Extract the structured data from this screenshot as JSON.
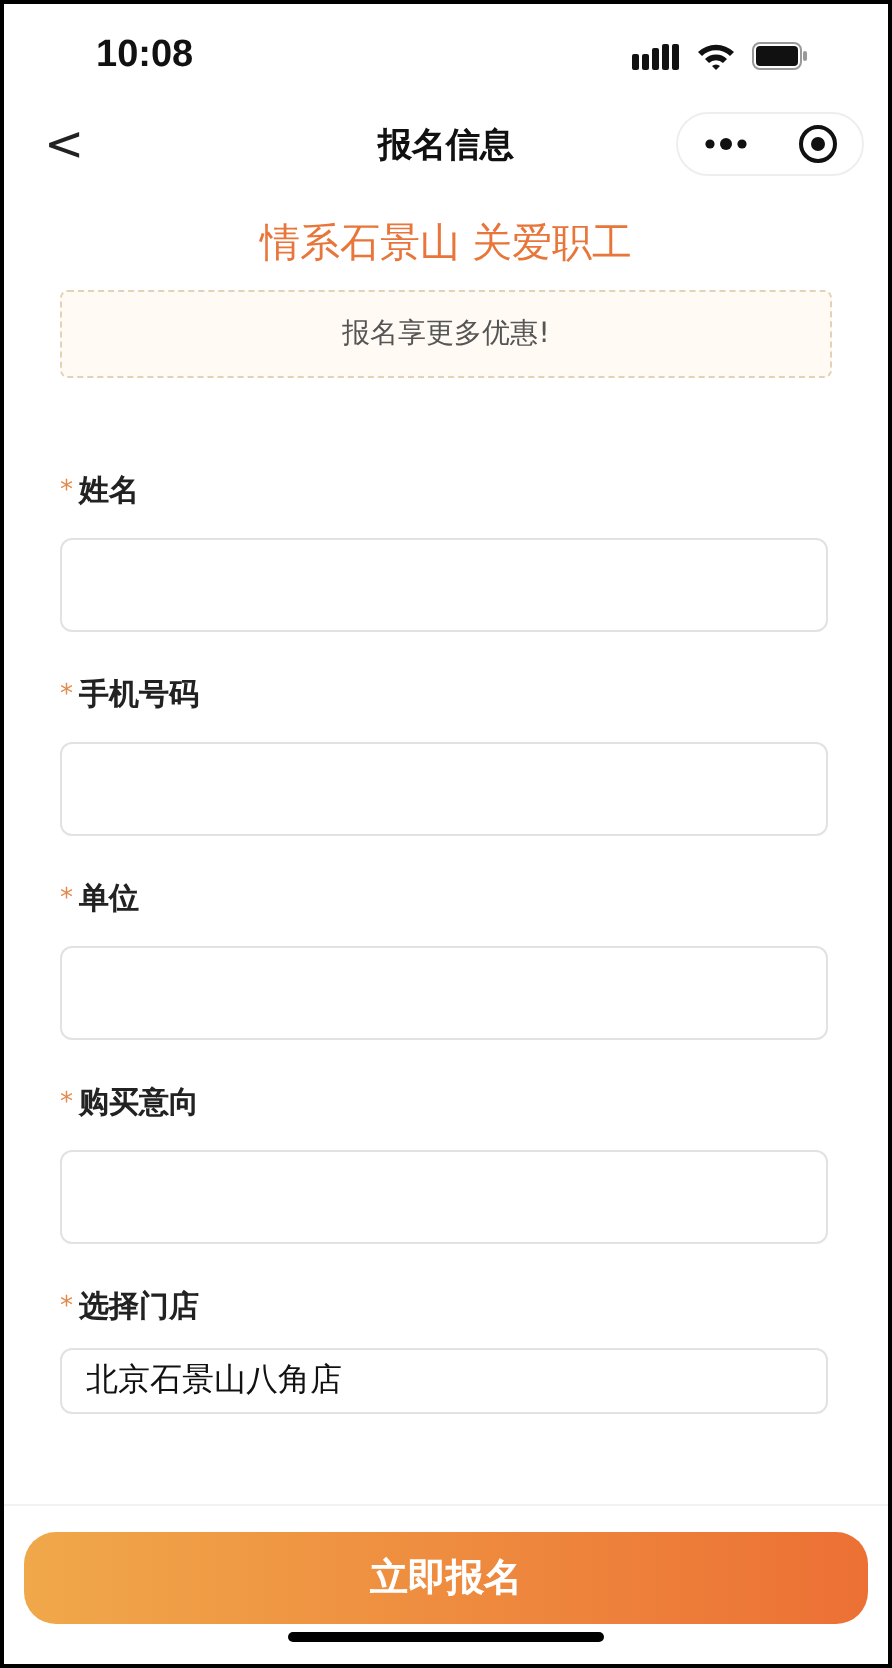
{
  "status_bar": {
    "time": "10:08"
  },
  "nav": {
    "back": "<",
    "title": "报名信息"
  },
  "heading": "情系石景山 关爱职工",
  "notice": "报名享更多优惠!",
  "fields": [
    {
      "marker": "*",
      "label": "姓名"
    },
    {
      "marker": "*",
      "label": "手机号码"
    },
    {
      "marker": "*",
      "label": "单位"
    },
    {
      "marker": "*",
      "label": "购买意向"
    },
    {
      "marker": "*",
      "label": "选择门店",
      "value": "北京石景山八角店"
    }
  ],
  "submit": "立即报名"
}
